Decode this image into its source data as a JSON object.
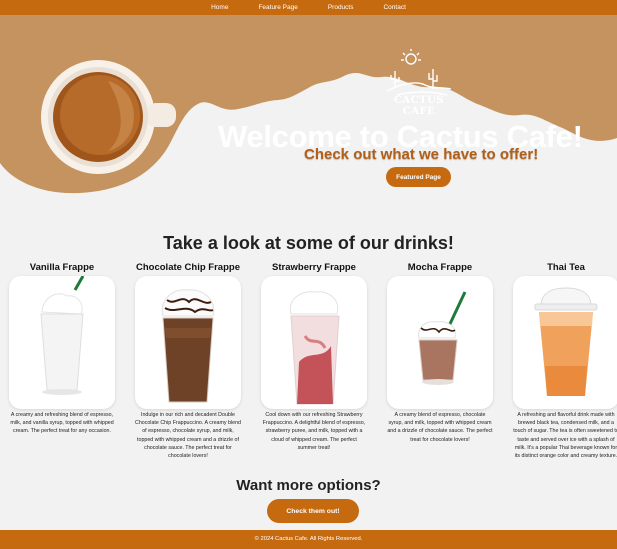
{
  "nav": {
    "items": [
      "Home",
      "Feature Page",
      "Products",
      "Contact"
    ]
  },
  "hero": {
    "logo_text": "CACTUS CAFE",
    "title": "Welcome to Cactus Cafe!",
    "subtitle": "Check out what we have to offer!",
    "button_label": "Featured Page"
  },
  "drinks_section": {
    "title": "Take a look at some of our drinks!",
    "items": [
      {
        "name": "Vanilla Frappe",
        "description": "A creamy and refreshing blend of espresso, milk, and vanilla syrup, topped with whipped cream. The perfect treat for any occasion."
      },
      {
        "name": "Chocolate Chip Frappe",
        "description": "Indulge in our rich and decadent Double Chocolate Chip Frappuccino. A creamy blend of espresso, chocolate syrup, and milk, topped with whipped cream and a drizzle of chocolate sauce. The perfect treat for chocolate lovers!"
      },
      {
        "name": "Strawberry Frappe",
        "description": "Cool down with our refreshing Strawberry Frappuccino. A delightful blend of espresso, strawberry puree, and milk, topped with a cloud of whipped cream. The perfect summer treat!"
      },
      {
        "name": "Mocha Frappe",
        "description": "A creamy blend of espresso, chocolate syrup, and milk, topped with whipped cream and a drizzle of chocolate sauce. The perfect treat for chocolate lovers!"
      },
      {
        "name": "Thai Tea",
        "description": "A refreshing and flavorful drink made with brewed black tea, condensed milk, and a touch of sugar. The tea is often sweetened to taste and served over ice with a splash of milk. It's a popular Thai beverage known for its distinct orange color and creamy texture."
      }
    ]
  },
  "more_section": {
    "title": "Want more options?",
    "button_label": "Check them out!"
  },
  "footer": {
    "text": "© 2024 Cactus Cafe. All Rights Reserved."
  },
  "colors": {
    "brand": "#c66a10",
    "hero_tan": "#c5935f",
    "background": "#f2f2f2"
  }
}
